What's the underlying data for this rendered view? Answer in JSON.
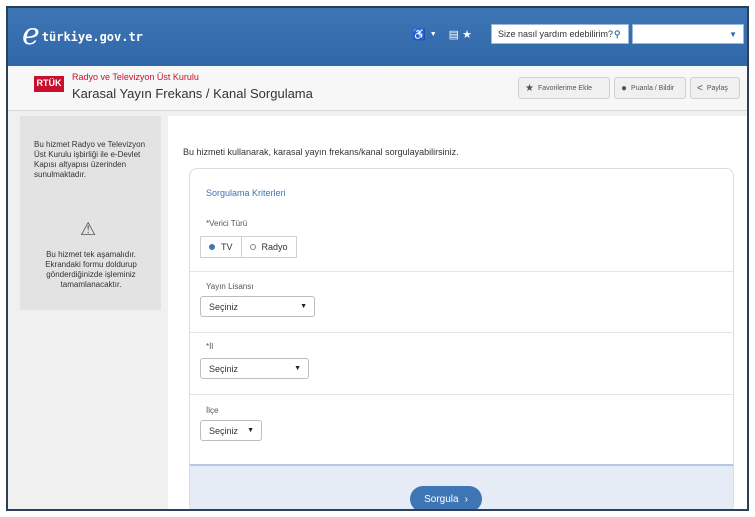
{
  "topbar": {
    "logo_text": "türkiye.gov.tr",
    "accessibility_icon": "accessibility-icon",
    "layout_icon": "layout-star-icon",
    "search_placeholder": "Size nasıl yardım edebilirim?",
    "search_icon": "search-icon",
    "select_value": ""
  },
  "header": {
    "logo": "RTÜK",
    "institution": "Radyo ve Televizyon Üst Kurulu",
    "title": "Karasal Yayın Frekans / Kanal Sorgulama",
    "favorites_label": "Favorilerime Ekle",
    "rate_label": "Puanla / Bildir",
    "share_label": "Paylaş"
  },
  "sidebar": {
    "info": "Bu hizmet Radyo ve Televizyon Üst Kurulu işbirliği ile e-Devlet Kapısı altyapısı üzerinden sunulmaktadır.",
    "warning_icon": "warning-icon",
    "steps": "Bu hizmet tek aşamalıdır. Ekrandaki formu doldurup gönderdiğinizde işleminiz tamamlanacaktır."
  },
  "main": {
    "intro": "Bu hizmeti kullanarak, karasal yayın frekans/kanal sorgulayabilirsiniz.",
    "criteria_title": "Sorgulama Kriterleri",
    "verici_label": "*Verici Türü",
    "radio_tv": "TV",
    "radio_radyo": "Radyo",
    "radio_selected": "TV",
    "yayin_label": "Yayın Lisansı",
    "yayin_value": "Seçiniz",
    "il_label": "*İl",
    "il_value": "Seçiniz",
    "ilce_label": "İlçe",
    "ilce_value": "Seçiniz",
    "submit_label": "Sorgula"
  },
  "colors": {
    "brand_blue": "#3d75b5",
    "rtuk_red": "#c8102e"
  }
}
